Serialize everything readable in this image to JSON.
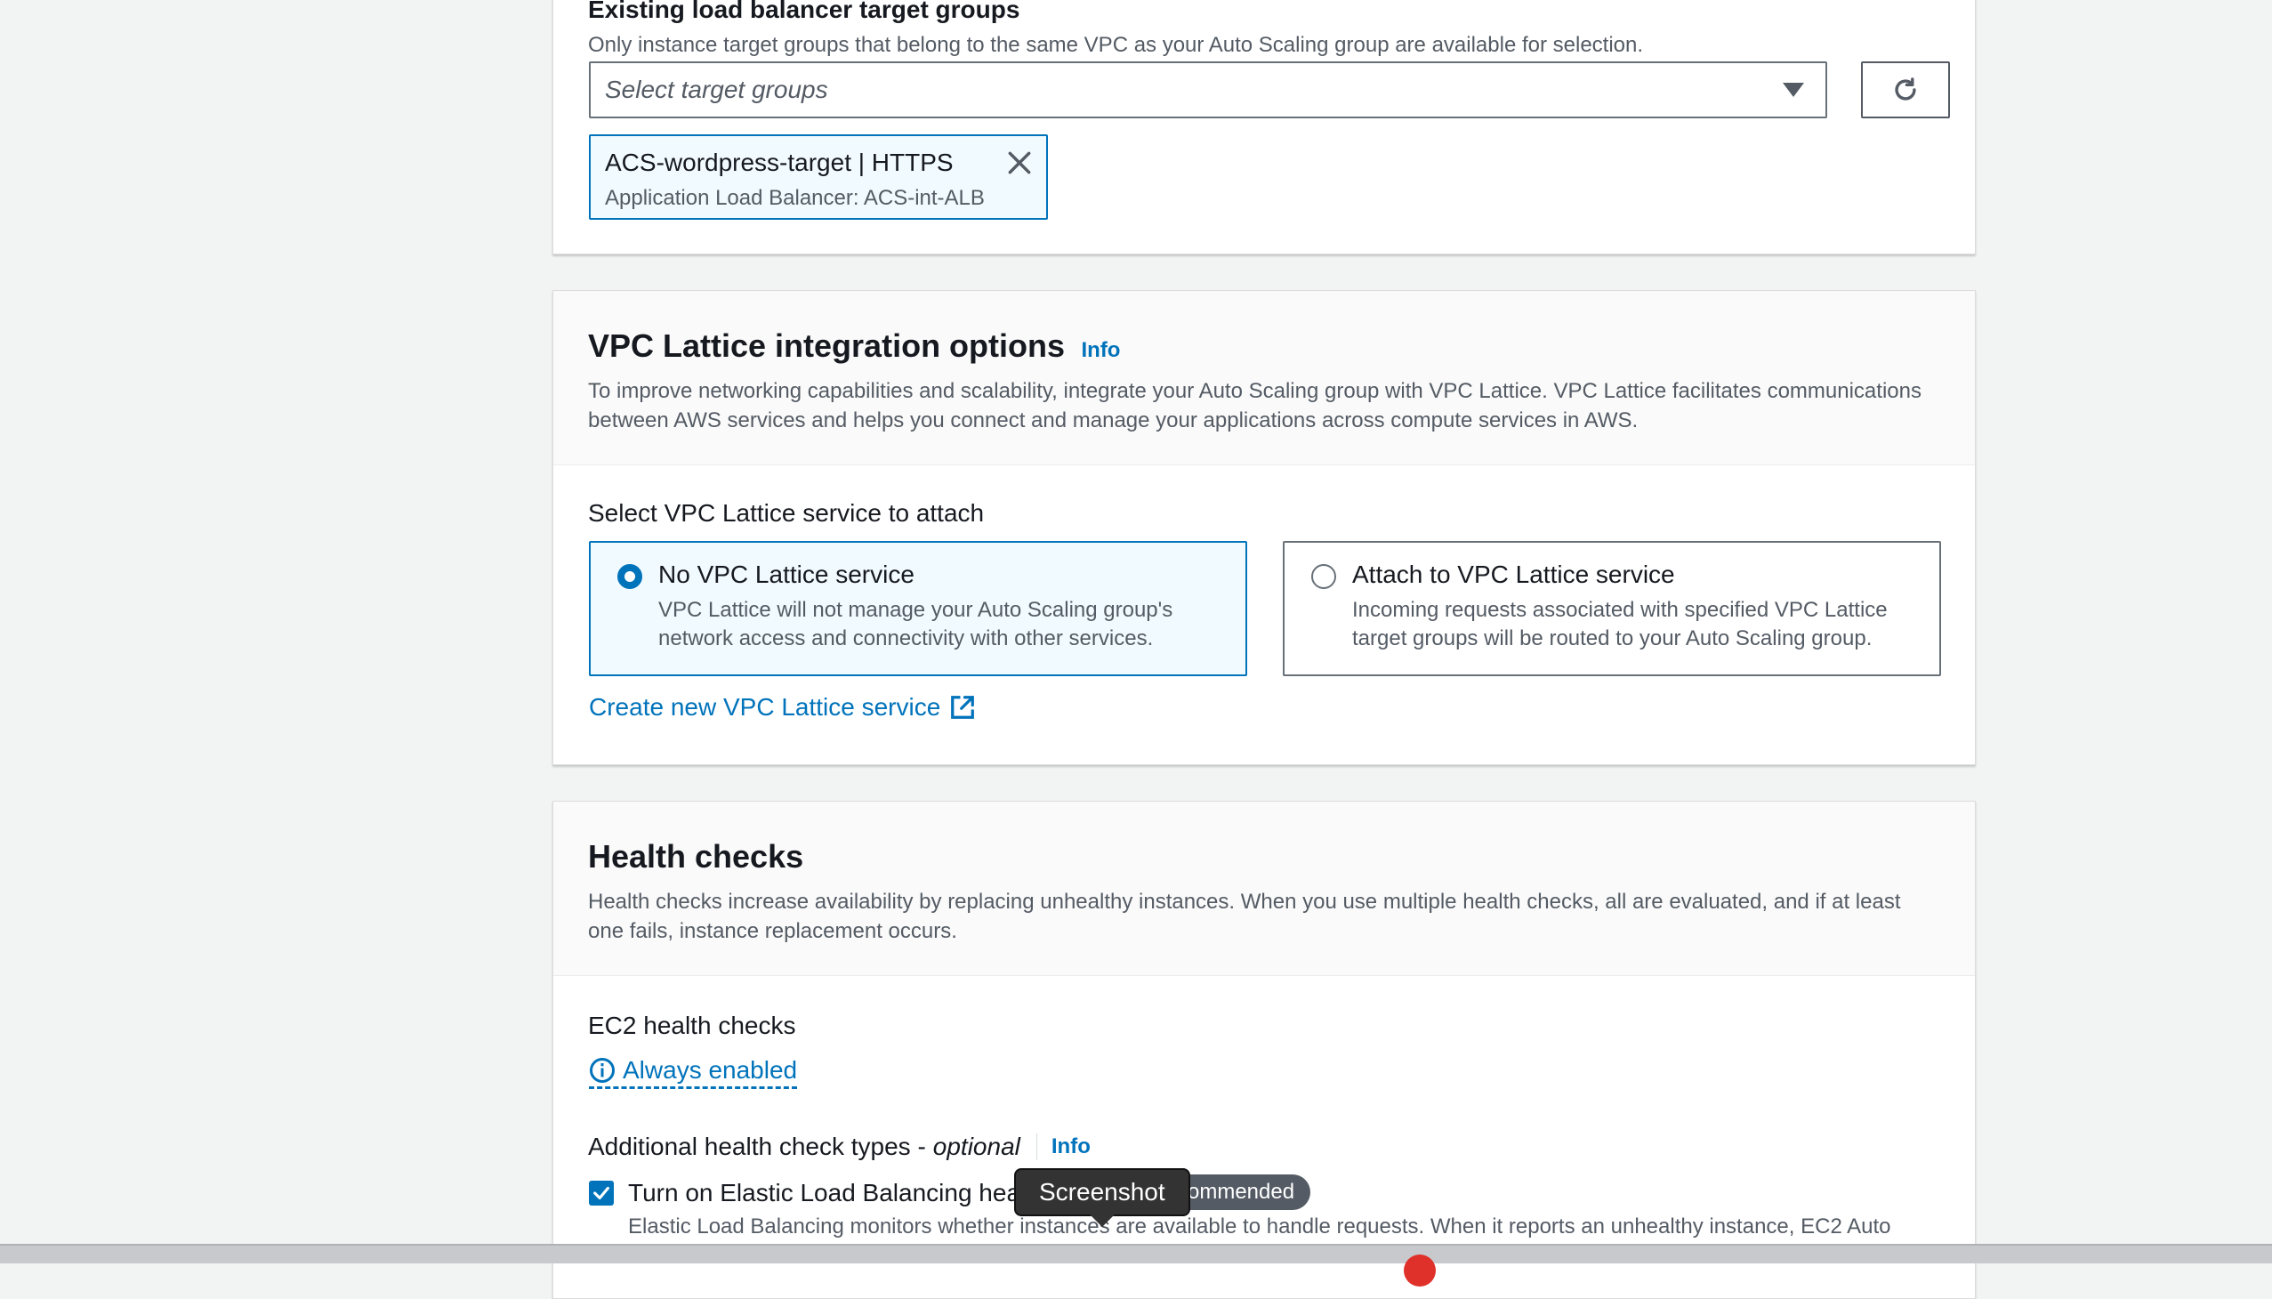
{
  "target_groups": {
    "title": "Existing load balancer target groups",
    "description": "Only instance target groups that belong to the same VPC as your Auto Scaling group are available for selection.",
    "select_placeholder": "Select target groups",
    "selected_token": {
      "title": "ACS-wordpress-target | HTTPS",
      "subtitle": "Application Load Balancer: ACS-int-ALB"
    }
  },
  "lattice": {
    "title": "VPC Lattice integration options",
    "info": "Info",
    "description": "To improve networking capabilities and scalability, integrate your Auto Scaling group with VPC Lattice. VPC Lattice facilitates communications between AWS services and helps you connect and manage your applications across compute services in AWS.",
    "select_label": "Select VPC Lattice service to attach",
    "options": [
      {
        "title": "No VPC Lattice service",
        "description": "VPC Lattice will not manage your Auto Scaling group's network access and connectivity with other services.",
        "selected": true
      },
      {
        "title": "Attach to VPC Lattice service",
        "description": "Incoming requests associated with specified VPC Lattice target groups will be routed to your Auto Scaling group.",
        "selected": false
      }
    ],
    "create_link": "Create new VPC Lattice service"
  },
  "health": {
    "title": "Health checks",
    "description": "Health checks increase availability by replacing unhealthy instances. When you use multiple health checks, all are evaluated, and if at least one fails, instance replacement occurs.",
    "ec2_label": "EC2 health checks",
    "always_enabled": "Always enabled",
    "additional_label": "Additional health check types - ",
    "additional_optional": "optional",
    "info": "Info",
    "elb_checkbox_label": "Turn on Elastic Load Balancing hea",
    "elb_checked": true,
    "recommended_badge": "ommended",
    "elb_description": "Elastic Load Balancing monitors whether instances are available to handle requests. When it reports an unhealthy instance, EC2 Auto"
  },
  "tooltip": {
    "text": "Screenshot"
  },
  "colors": {
    "link": "#0073bb",
    "background": "#f2f3f3",
    "selected_card_bg": "#f1faff"
  },
  "icons": [
    "caret-down-icon",
    "refresh-icon",
    "close-icon",
    "external-link-icon",
    "info-circle-icon",
    "checkmark-icon"
  ]
}
